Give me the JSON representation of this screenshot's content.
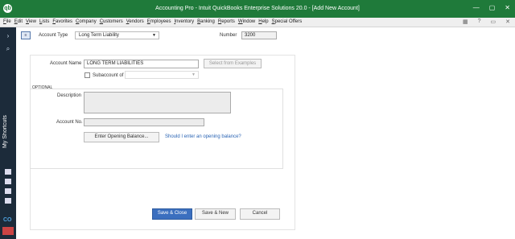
{
  "window": {
    "title": "Accounting Pro - Intuit QuickBooks Enterprise Solutions 20.0 - [Add New Account]",
    "controls": [
      "—",
      "▢",
      "✕"
    ]
  },
  "menubar": {
    "items": [
      "File",
      "Edit",
      "View",
      "Lists",
      "Favorites",
      "Company",
      "Customers",
      "Vendors",
      "Employees",
      "Inventory",
      "Banking",
      "Reports",
      "Window",
      "Help",
      "Special Offers"
    ],
    "right_icons": [
      "calendar-icon",
      "help-icon",
      "minimize-icon",
      "close-icon"
    ]
  },
  "sidebar": {
    "shortcuts_label": "My Shortcuts",
    "company_label": "CO"
  },
  "form": {
    "account_type_label": "Account Type",
    "account_type_value": "Long Term Liability",
    "number_label": "Number",
    "number_value": "3200",
    "account_name_label": "Account Name",
    "account_name_value": "LONG TERM LIABILITIES",
    "select_examples_label": "Select from Examples",
    "subaccount_label": "Subaccount of",
    "subaccount_value": "",
    "optional_label": "OPTIONAL",
    "description_label": "Description",
    "description_value": "",
    "account_no_label": "Account No.",
    "account_no_value": "",
    "opening_balance_button": "Enter Opening Balance...",
    "opening_balance_link": "Should I enter an opening balance?"
  },
  "buttons": {
    "save_close": "Save & Close",
    "save_new": "Save & New",
    "cancel": "Cancel"
  },
  "colors": {
    "title_bar": "#1f7a3a",
    "sidebar": "#1c2b3a",
    "primary_button": "#3b6fbf"
  }
}
